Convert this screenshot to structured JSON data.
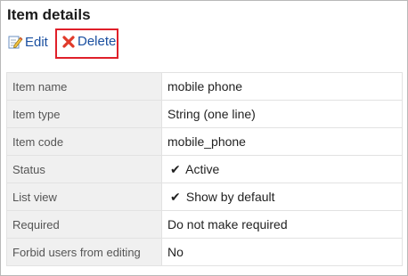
{
  "title": "Item details",
  "actions": {
    "edit_label": "Edit",
    "delete_label": "Delete"
  },
  "rows": [
    {
      "label": "Item name",
      "value": "mobile phone"
    },
    {
      "label": "Item type",
      "value": "String (one line)"
    },
    {
      "label": "Item code",
      "value": "mobile_phone"
    },
    {
      "label": "Status",
      "value": "Active",
      "checked": true
    },
    {
      "label": "List view",
      "value": "Show by default",
      "checked": true
    },
    {
      "label": "Required",
      "value": "Do not make required"
    },
    {
      "label": "Forbid users from editing",
      "value": "No"
    }
  ],
  "colors": {
    "link": "#1a4fa0",
    "highlight": "#e0202a",
    "label_bg": "#f0f0f0"
  },
  "icons": {
    "edit": "pencil-edit-icon",
    "delete": "red-x-icon",
    "check": "checkmark-icon"
  }
}
